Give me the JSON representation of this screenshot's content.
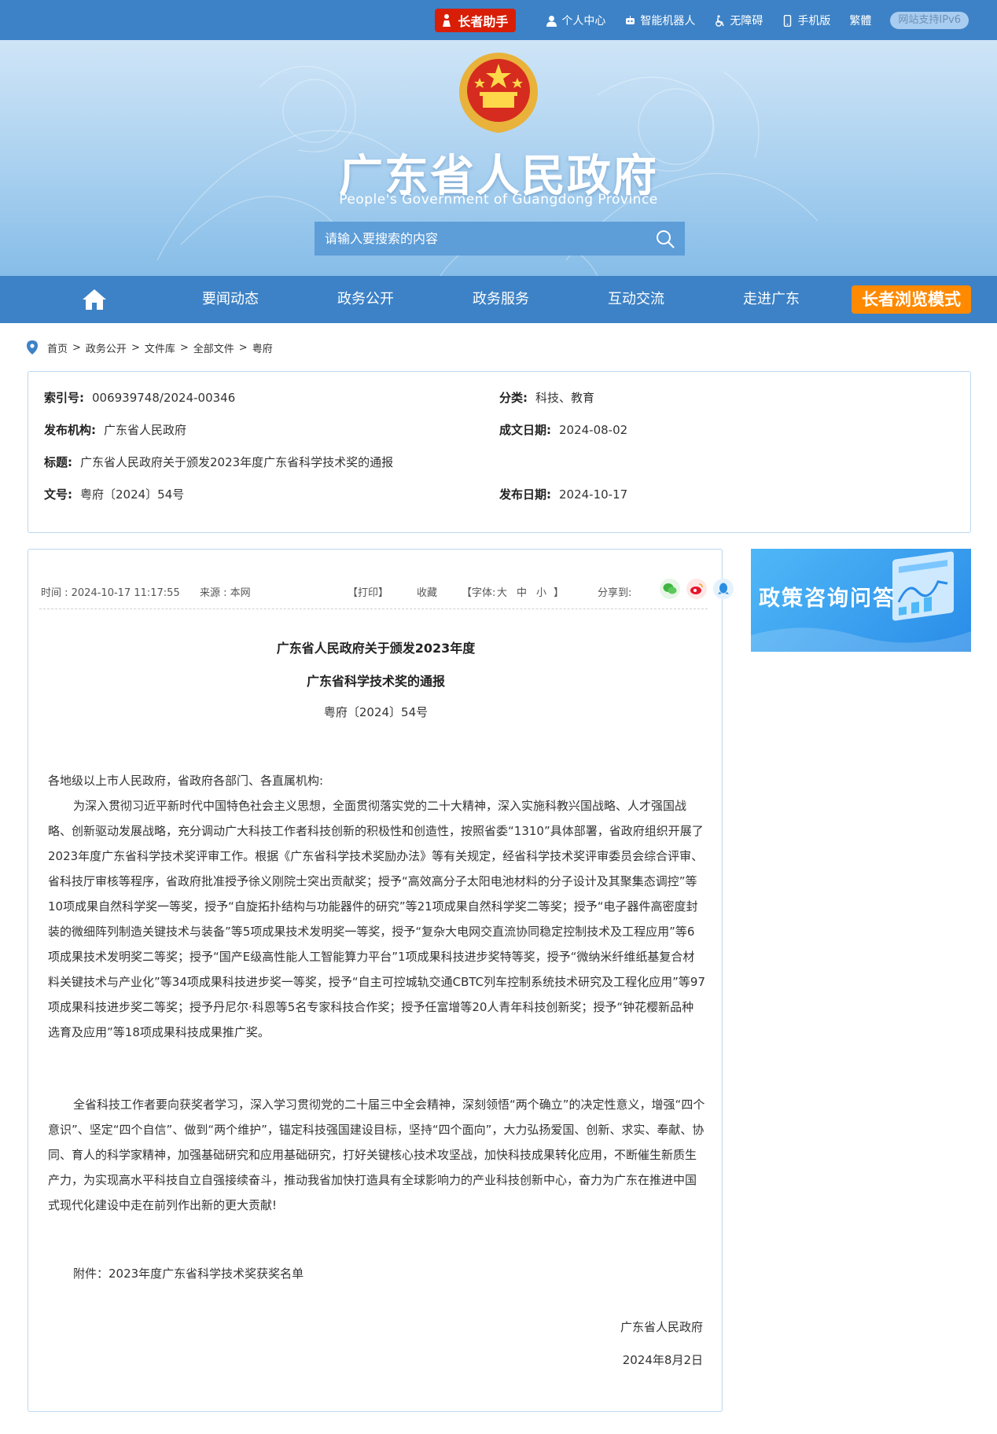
{
  "topbar": {
    "elder_helper": "长者助手",
    "links": [
      "个人中心",
      "智能机器人",
      "无障碍",
      "手机版",
      "繁體"
    ],
    "ipv6": "网站支持IPv6"
  },
  "banner": {
    "title": "广东省人民政府",
    "subtitle": "People's Government of Guangdong Province",
    "search_placeholder": "请输入要搜索的内容"
  },
  "nav": {
    "items": [
      "要闻动态",
      "政务公开",
      "政务服务",
      "互动交流",
      "走进广东"
    ],
    "elder_mode": "长者浏览模式"
  },
  "breadcrumb": [
    "首页",
    "政务公开",
    "文件库",
    "全部文件",
    "粤府"
  ],
  "meta": {
    "index_no": {
      "k": "索引号:",
      "v": "006939748/2024-00346"
    },
    "category": {
      "k": "分类:",
      "v": "科技、教育"
    },
    "issuer": {
      "k": "发布机构:",
      "v": "广东省人民政府"
    },
    "written_date": {
      "k": "成文日期:",
      "v": "2024-08-02"
    },
    "title": {
      "k": "标题:",
      "v": "广东省人民政府关于颁发2023年度广东省科学技术奖的通报"
    },
    "doc_no": {
      "k": "文号:",
      "v": "粤府〔2024〕54号"
    },
    "publish_date": {
      "k": "发布日期:",
      "v": "2024-10-17"
    }
  },
  "toolbar": {
    "time": "时间 : 2024-10-17 11:17:55",
    "source": "来源 : 本网",
    "print": "【打印】",
    "favorite": "收藏",
    "font_label": "【字体:",
    "font_large": "大",
    "font_medium": "中",
    "font_small": "小",
    "font_close": "】",
    "share": "分享到:"
  },
  "article": {
    "title_line1": "广东省人民政府关于颁发2023年度",
    "title_line2": "广东省科学技术奖的通报",
    "doc_no": "粤府〔2024〕54号",
    "salutation": "各地级以上市人民政府，省政府各部门、各直属机构:",
    "para1": "为深入贯彻习近平新时代中国特色社会主义思想，全面贯彻落实党的二十大精神，深入实施科教兴国战略、人才强国战略、创新驱动发展战略，充分调动广大科技工作者科技创新的积极性和创造性，按照省委“1310”具体部署，省政府组织开展了2023年度广东省科学技术奖评审工作。根据《广东省科学技术奖励办法》等有关规定，经省科学技术奖评审委员会综合评审、省科技厅审核等程序，省政府批准授予徐义刚院士突出贡献奖；授予“高效高分子太阳电池材料的分子设计及其聚集态调控”等10项成果自然科学奖一等奖，授予“自旋拓扑结构与功能器件的研究”等21项成果自然科学奖二等奖；授予“电子器件高密度封装的微细阵列制造关键技术与装备”等5项成果技术发明奖一等奖，授予“复杂大电网交直流协同稳定控制技术及工程应用”等6项成果技术发明奖二等奖；授予“国产E级高性能人工智能算力平台”1项成果科技进步奖特等奖，授予“微纳米纤维纸基复合材料关键技术与产业化”等34项成果科技进步奖一等奖，授予“自主可控城轨交通CBTC列车控制系统技术研究及工程化应用”等97项成果科技进步奖二等奖；授予丹尼尔·科恩等5名专家科技合作奖；授予任富增等20人青年科技创新奖；授予“钟花樱新品种选育及应用”等18项成果科技成果推广奖。",
    "para2": "全省科技工作者要向获奖者学习，深入学习贯彻党的二十届三中全会精神，深刻领悟“两个确立”的决定性意义，增强“四个意识”、坚定“四个自信”、做到“两个维护”，锚定科技强国建设目标，坚持“四个面向”，大力弘扬爱国、创新、求实、奉献、协同、育人的科学家精神，加强基础研究和应用基础研究，打好关键核心技术攻坚战，加快科技成果转化应用，不断催生新质生产力，为实现高水平科技自立自强接续奋斗，推动我省加快打造具有全球影响力的产业科技创新中心，奋力为广东在推进中国式现代化建设中走在前列作出新的更大贡献!",
    "attachment": "附件：2023年度广东省科学技术奖获奖名单",
    "signer": "广东省人民政府",
    "sign_date": "2024年8月2日"
  },
  "side_banner": {
    "text": "政策咨询问答"
  },
  "colors": {
    "primary": "#3d82c6",
    "elder_red": "#d81e06",
    "elder_orange": "#ff8a00",
    "border": "#bcd8ef"
  }
}
